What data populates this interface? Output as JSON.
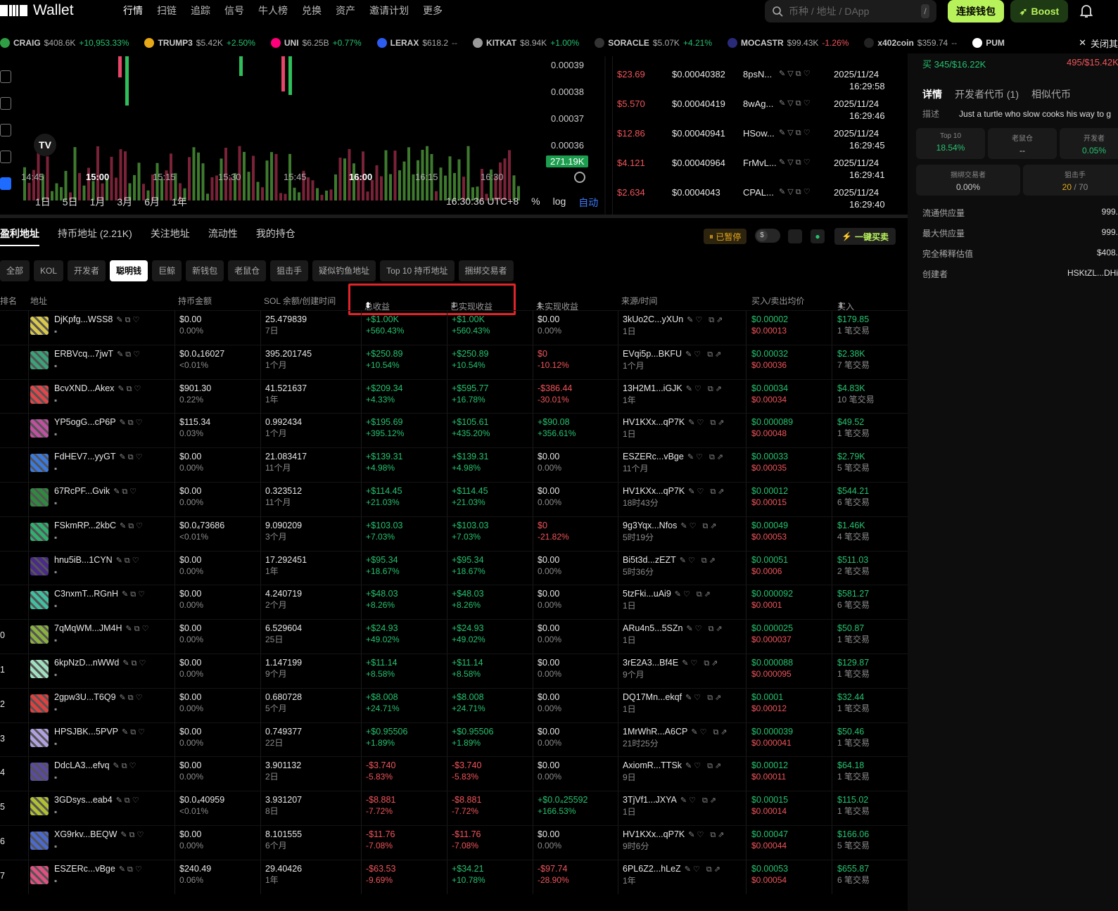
{
  "nav": {
    "logo": "Wallet",
    "links": [
      "行情",
      "扫链",
      "追踪",
      "信号",
      "牛人榜",
      "兑换",
      "资产",
      "邀请计划",
      "更多"
    ],
    "search_placeholder": "币种 / 地址 / DApp",
    "search_hint": "/",
    "connect": "连接钱包",
    "boost": "Boost"
  },
  "ticker": [
    {
      "sym": "CRAIG",
      "price": "$408.6K",
      "chg": "+10,953.33%",
      "dir": "g",
      "color": "#2f9e44"
    },
    {
      "sym": "TRUMP3",
      "price": "$5.42K",
      "chg": "+2.50%",
      "dir": "g",
      "color": "#e6a817"
    },
    {
      "sym": "UNI",
      "price": "$6.25B",
      "chg": "+0.77%",
      "dir": "g",
      "color": "#ff007a"
    },
    {
      "sym": "LERAX",
      "price": "$618.2",
      "chg": "--",
      "dir": "m",
      "color": "#2c5cf0"
    },
    {
      "sym": "KITKAT",
      "price": "$8.94K",
      "chg": "+1.00%",
      "dir": "g",
      "color": "#999"
    },
    {
      "sym": "SORACLE",
      "price": "$5.07K",
      "chg": "+4.21%",
      "dir": "g",
      "color": "#333"
    },
    {
      "sym": "MOCASTR",
      "price": "$99.43K",
      "chg": "-1.26%",
      "dir": "r",
      "color": "#2a2a7a"
    },
    {
      "sym": "x402coin",
      "price": "$359.74",
      "chg": "--",
      "dir": "m",
      "color": "#222"
    },
    {
      "sym": "PUM",
      "price": "",
      "chg": "",
      "dir": "m",
      "color": "#fff"
    }
  ],
  "ticker_close": "关闭其",
  "chart_data": {
    "type": "candlestick",
    "y_labels": [
      "0.00039",
      "0.00038",
      "0.00037",
      "0.00036"
    ],
    "x_labels": [
      "14:45",
      "15:00",
      "15:15",
      "15:30",
      "15:45",
      "16:00",
      "16:15",
      "16:30"
    ],
    "last_price_label": "271.19K"
  },
  "periods": [
    "1日",
    "5日",
    "1月",
    "3月",
    "6月",
    "1年"
  ],
  "chart_footer": {
    "time": "16:30:36 UTC+8",
    "pct": "%",
    "log": "log",
    "auto": "自动"
  },
  "trades": [
    {
      "amt": "$23.69",
      "price": "$0.00040382",
      "maker": "8psN...",
      "date": "2025/11/24",
      "time": "16:29:58"
    },
    {
      "amt": "$5.570",
      "price": "$0.00040419",
      "maker": "8wAg...",
      "date": "2025/11/24",
      "time": "16:29:46"
    },
    {
      "amt": "$12.86",
      "price": "$0.00040941",
      "maker": "HSow...",
      "date": "2025/11/24",
      "time": "16:29:45"
    },
    {
      "amt": "$4.121",
      "price": "$0.00040964",
      "maker": "FrMvL...",
      "date": "2025/11/24",
      "time": "16:29:41"
    },
    {
      "amt": "$2.634",
      "price": "$0.0004043",
      "maker": "CPAL...",
      "date": "2025/11/24",
      "time": "16:29:40"
    }
  ],
  "right": {
    "top_left": "买 345/$16.22K",
    "top_right": "495/$15.42K",
    "tabs": [
      "详情",
      "开发者代币 (1)",
      "相似代币"
    ],
    "desc_label": "描述",
    "desc": "Just a turtle who slow cooks his way to g",
    "cards": [
      {
        "label": "Top 10",
        "value": "18.54%"
      },
      {
        "label": "老鼠仓",
        "value": "--"
      },
      {
        "label": "开发者",
        "value": "0.05%"
      },
      {
        "label": "捆绑交易者",
        "value": "0.00%"
      },
      {
        "label": "狙击手",
        "value": "20",
        "value2": "/ 70"
      }
    ],
    "kv": [
      {
        "k": "流通供应量",
        "v": "999."
      },
      {
        "k": "最大供应量",
        "v": "999."
      },
      {
        "k": "完全稀释估值",
        "v": "$408."
      },
      {
        "k": "创建者",
        "v": "HSKtZL...DHi"
      }
    ]
  },
  "list_tabs": [
    "盈利地址",
    "持币地址 (2.21K)",
    "关注地址",
    "流动性",
    "我的持仓"
  ],
  "paused": "已暂停",
  "one_key": "一键买卖",
  "filters": [
    "全部",
    "KOL",
    "开发者",
    "聪明钱",
    "巨鲸",
    "新钱包",
    "老鼠仓",
    "狙击手",
    "疑似钓鱼地址",
    "Top 10 持币地址",
    "捆绑交易者"
  ],
  "headers": {
    "rank": "排名",
    "addr": "地址",
    "hold": "持币金额",
    "sol": "SOL 余额/创建时间",
    "total": "总收益",
    "realized": "已实现收益",
    "unrealized": "未实现收益",
    "source": "来源/时间",
    "avg": "买入/卖出均价",
    "buy": "买入"
  },
  "rows": [
    {
      "rank": "",
      "addr": "DjKpfg...WSS8",
      "h1": "$0.00",
      "h2": "0.00%",
      "s1": "25.479839",
      "s2": "7日",
      "t1": "+$1.00K",
      "t2": "+560.43%",
      "tc": "g",
      "r1": "+$1.00K",
      "r2": "+560.43%",
      "rc": "g",
      "u1": "$0.00",
      "u2": "0.00%",
      "uc": "w",
      "src": "3kUo2C...yXUn",
      "st": "1日",
      "b1": "$0.00002",
      "b2": "$0.00013",
      "v1": "$179.85",
      "v2": "1 笔交易",
      "av": "#d9c84a"
    },
    {
      "rank": "",
      "addr": "ERBVcq...7jwT",
      "h1": "$0.0₄16027",
      "h2": "<0.01%",
      "s1": "395.201745",
      "s2": "1个月",
      "t1": "+$250.89",
      "t2": "+10.54%",
      "tc": "g",
      "r1": "+$250.89",
      "r2": "+10.54%",
      "rc": "g",
      "u1": "$0",
      "u2": "-10.12%",
      "uc": "r",
      "src": "EVqi5p...BKFU",
      "st": "1个月",
      "b1": "$0.00032",
      "b2": "$0.00036",
      "v1": "$2.38K",
      "v2": "7 笔交易",
      "av": "#3aa37a"
    },
    {
      "rank": "",
      "addr": "BcvXND...Akex",
      "h1": "$901.30",
      "h2": "0.22%",
      "s1": "41.521637",
      "s2": "1年",
      "t1": "+$209.34",
      "t2": "+4.33%",
      "tc": "g",
      "r1": "+$595.77",
      "r2": "+16.78%",
      "rc": "g",
      "u1": "-$386.44",
      "u2": "-30.01%",
      "uc": "r",
      "src": "13H2M1...iGJK",
      "st": "1年",
      "b1": "$0.00034",
      "b2": "$0.00034",
      "v1": "$4.83K",
      "v2": "10 笔交易",
      "av": "#e0464a"
    },
    {
      "rank": "",
      "addr": "YP5ogG...cP6P",
      "h1": "$115.34",
      "h2": "0.03%",
      "s1": "0.992434",
      "s2": "1个月",
      "t1": "+$195.69",
      "t2": "+395.12%",
      "tc": "g",
      "r1": "+$105.61",
      "r2": "+435.20%",
      "rc": "g",
      "u1": "+$90.08",
      "u2": "+356.61%",
      "uc": "g",
      "src": "HV1KXx...qP7K",
      "st": "1日",
      "b1": "$0.000089",
      "b2": "$0.00048",
      "v1": "$49.52",
      "v2": "1 笔交易",
      "av": "#c050a0"
    },
    {
      "rank": "",
      "addr": "FdHEV7...yyGT",
      "h1": "$0.00",
      "h2": "0.00%",
      "s1": "21.083417",
      "s2": "11个月",
      "t1": "+$139.31",
      "t2": "+4.98%",
      "tc": "g",
      "r1": "+$139.31",
      "r2": "+4.98%",
      "rc": "g",
      "u1": "$0.00",
      "u2": "0.00%",
      "uc": "w",
      "src": "ESZERc...vBge",
      "st": "11个月",
      "b1": "$0.00033",
      "b2": "$0.00035",
      "v1": "$2.79K",
      "v2": "5 笔交易",
      "av": "#3a7ae0"
    },
    {
      "rank": "",
      "addr": "67RcPF...Gvik",
      "h1": "$0.00",
      "h2": "0.00%",
      "s1": "0.323512",
      "s2": "11个月",
      "t1": "+$114.45",
      "t2": "+21.03%",
      "tc": "g",
      "r1": "+$114.45",
      "r2": "+21.03%",
      "rc": "g",
      "u1": "$0.00",
      "u2": "0.00%",
      "uc": "w",
      "src": "HV1KXx...qP7K",
      "st": "18时43分",
      "b1": "$0.00012",
      "b2": "$0.00015",
      "v1": "$544.21",
      "v2": "6 笔交易",
      "av": "#2e8a3e"
    },
    {
      "rank": "",
      "addr": "FSkmRP...2kbC",
      "h1": "$0.0₄73686",
      "h2": "<0.01%",
      "s1": "9.090209",
      "s2": "3个月",
      "t1": "+$103.03",
      "t2": "+7.03%",
      "tc": "g",
      "r1": "+$103.03",
      "r2": "+7.03%",
      "rc": "g",
      "u1": "$0",
      "u2": "-21.82%",
      "uc": "r",
      "src": "9g3Yqx...Nfos",
      "st": "5时19分",
      "b1": "$0.00049",
      "b2": "$0.00053",
      "v1": "$1.46K",
      "v2": "4 笔交易",
      "av": "#30b070"
    },
    {
      "rank": "",
      "addr": "hnu5iB...1CYN",
      "h1": "$0.00",
      "h2": "0.00%",
      "s1": "17.292451",
      "s2": "1年",
      "t1": "+$95.34",
      "t2": "+18.67%",
      "tc": "g",
      "r1": "+$95.34",
      "r2": "+18.67%",
      "rc": "g",
      "u1": "$0.00",
      "u2": "0.00%",
      "uc": "w",
      "src": "Bi5t3d...zEZT",
      "st": "5时36分",
      "b1": "$0.00051",
      "b2": "$0.0006",
      "v1": "$511.03",
      "v2": "2 笔交易",
      "av": "#4a2a8a"
    },
    {
      "rank": "",
      "addr": "C3nxmT...RGnH",
      "h1": "$0.00",
      "h2": "0.00%",
      "s1": "4.240719",
      "s2": "2个月",
      "t1": "+$48.03",
      "t2": "+8.26%",
      "tc": "g",
      "r1": "+$48.03",
      "r2": "+8.26%",
      "rc": "g",
      "u1": "$0.00",
      "u2": "0.00%",
      "uc": "w",
      "src": "5tzFki...uAi9",
      "st": "1日",
      "b1": "$0.000092",
      "b2": "$0.0001",
      "v1": "$581.27",
      "v2": "6 笔交易",
      "av": "#40c0a0"
    },
    {
      "rank": "0",
      "addr": "7qMqWM...JM4H",
      "h1": "$0.00",
      "h2": "0.00%",
      "s1": "6.529604",
      "s2": "25日",
      "t1": "+$24.93",
      "t2": "+49.02%",
      "tc": "g",
      "r1": "+$24.93",
      "r2": "+49.02%",
      "rc": "g",
      "u1": "$0.00",
      "u2": "0.00%",
      "uc": "w",
      "src": "ARu4n5...5SZn",
      "st": "1日",
      "b1": "$0.000025",
      "b2": "$0.000037",
      "v1": "$50.87",
      "v2": "1 笔交易",
      "av": "#8ab040"
    },
    {
      "rank": "1",
      "addr": "6kpNzD...nWWd",
      "h1": "$0.00",
      "h2": "0.00%",
      "s1": "1.147199",
      "s2": "9个月",
      "t1": "+$11.14",
      "t2": "+8.58%",
      "tc": "g",
      "r1": "+$11.14",
      "r2": "+8.58%",
      "rc": "g",
      "u1": "$0.00",
      "u2": "0.00%",
      "uc": "w",
      "src": "3rE2A3...Bf4E",
      "st": "9个月",
      "b1": "$0.000088",
      "b2": "$0.000095",
      "v1": "$129.87",
      "v2": "1 笔交易",
      "av": "#a0e0c0"
    },
    {
      "rank": "2",
      "addr": "2gpw3U...T6Q9",
      "h1": "$0.00",
      "h2": "0.00%",
      "s1": "0.680728",
      "s2": "5个月",
      "t1": "+$8.008",
      "t2": "+24.71%",
      "tc": "g",
      "r1": "+$8.008",
      "r2": "+24.71%",
      "rc": "g",
      "u1": "$0.00",
      "u2": "0.00%",
      "uc": "w",
      "src": "DQ17Mn...ekqf",
      "st": "1日",
      "b1": "$0.0001",
      "b2": "$0.00012",
      "v1": "$32.44",
      "v2": "1 笔交易",
      "av": "#e04040"
    },
    {
      "rank": "3",
      "addr": "HPSJBK...5PVP",
      "h1": "$0.00",
      "h2": "0.00%",
      "s1": "0.749377",
      "s2": "22日",
      "t1": "+$0.95506",
      "t2": "+1.89%",
      "tc": "g",
      "r1": "+$0.95506",
      "r2": "+1.89%",
      "rc": "g",
      "u1": "$0.00",
      "u2": "0.00%",
      "uc": "w",
      "src": "1MrWhR...A6CP",
      "st": "21时25分",
      "b1": "$0.000039",
      "b2": "$0.000041",
      "v1": "$50.46",
      "v2": "1 笔交易",
      "av": "#b0a0e0"
    },
    {
      "rank": "4",
      "addr": "DdcLA3...efvq",
      "h1": "$0.00",
      "h2": "0.00%",
      "s1": "3.901132",
      "s2": "2日",
      "t1": "-$3.740",
      "t2": "-5.83%",
      "tc": "r",
      "r1": "-$3.740",
      "r2": "-5.83%",
      "rc": "r",
      "u1": "$0.00",
      "u2": "0.00%",
      "uc": "w",
      "src": "AxiomR...TTSk",
      "st": "9日",
      "b1": "$0.00012",
      "b2": "$0.00011",
      "v1": "$64.18",
      "v2": "1 笔交易",
      "av": "#5a4aa0"
    },
    {
      "rank": "5",
      "addr": "3GDsys...eab4",
      "h1": "$0.0₄40959",
      "h2": "<0.01%",
      "s1": "3.931207",
      "s2": "8日",
      "t1": "-$8.881",
      "t2": "-7.72%",
      "tc": "r",
      "r1": "-$8.881",
      "r2": "-7.72%",
      "rc": "r",
      "u1": "+$0.0₄25592",
      "u2": "+166.53%",
      "uc": "g",
      "src": "3TjVf1...JXYA",
      "st": "1日",
      "b1": "$0.00015",
      "b2": "$0.00014",
      "v1": "$115.02",
      "v2": "1 笔交易",
      "av": "#b0c030"
    },
    {
      "rank": "6",
      "addr": "XG9rkv...BEQW",
      "h1": "$0.00",
      "h2": "0.00%",
      "s1": "8.101555",
      "s2": "6个月",
      "t1": "-$11.76",
      "t2": "-7.08%",
      "tc": "r",
      "r1": "-$11.76",
      "r2": "-7.08%",
      "rc": "r",
      "u1": "$0.00",
      "u2": "0.00%",
      "uc": "w",
      "src": "HV1KXx...qP7K",
      "st": "9时6分",
      "b1": "$0.00047",
      "b2": "$0.00044",
      "v1": "$166.06",
      "v2": "5 笔交易",
      "av": "#4a6ad0"
    },
    {
      "rank": "7",
      "addr": "ESZERc...vBge",
      "h1": "$240.49",
      "h2": "0.06%",
      "s1": "29.40426",
      "s2": "1年",
      "t1": "-$63.53",
      "t2": "-9.69%",
      "tc": "r",
      "r1": "+$34.21",
      "r2": "+10.78%",
      "rc": "g",
      "u1": "-$97.74",
      "u2": "-28.90%",
      "uc": "r",
      "src": "6PL6Z2...hLeZ",
      "st": "1年",
      "b1": "$0.00053",
      "b2": "$0.00054",
      "v1": "$655.87",
      "v2": "6 笔交易",
      "av": "#e05080"
    }
  ]
}
